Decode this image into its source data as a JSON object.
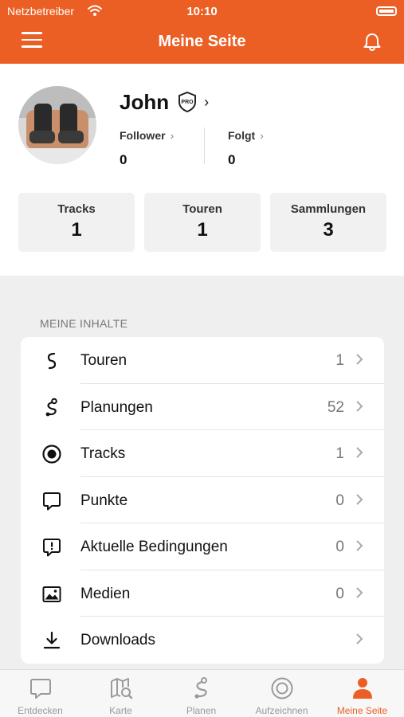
{
  "status_bar": {
    "carrier": "Netzbetreiber",
    "time": "10:10"
  },
  "header": {
    "title": "Meine Seite"
  },
  "profile": {
    "name": "John",
    "follower_label": "Follower",
    "follower_count": "0",
    "following_label": "Folgt",
    "following_count": "0"
  },
  "stats": [
    {
      "label": "Tracks",
      "value": "1"
    },
    {
      "label": "Touren",
      "value": "1"
    },
    {
      "label": "Sammlungen",
      "value": "3"
    }
  ],
  "content_section": {
    "heading": "MEINE INHALTE",
    "items": [
      {
        "label": "Touren",
        "count": "1",
        "icon": "tour-route-icon"
      },
      {
        "label": "Planungen",
        "count": "52",
        "icon": "planning-route-icon"
      },
      {
        "label": "Tracks",
        "count": "1",
        "icon": "record-dot-icon"
      },
      {
        "label": "Punkte",
        "count": "0",
        "icon": "speech-bubble-icon"
      },
      {
        "label": "Aktuelle Bedingungen",
        "count": "0",
        "icon": "conditions-bubble-icon"
      },
      {
        "label": "Medien",
        "count": "0",
        "icon": "image-icon"
      },
      {
        "label": "Downloads",
        "count": "",
        "icon": "download-icon"
      }
    ]
  },
  "tab_bar": {
    "tabs": [
      {
        "label": "Entdecken",
        "icon": "discover-bubble-icon"
      },
      {
        "label": "Karte",
        "icon": "map-search-icon"
      },
      {
        "label": "Planen",
        "icon": "plan-route-icon"
      },
      {
        "label": "Aufzeichnen",
        "icon": "record-icon"
      },
      {
        "label": "Meine Seite",
        "icon": "profile-person-icon",
        "active": true
      }
    ]
  },
  "colors": {
    "accent": "#ec5f24",
    "background": "#efefef",
    "card": "#ffffff"
  }
}
